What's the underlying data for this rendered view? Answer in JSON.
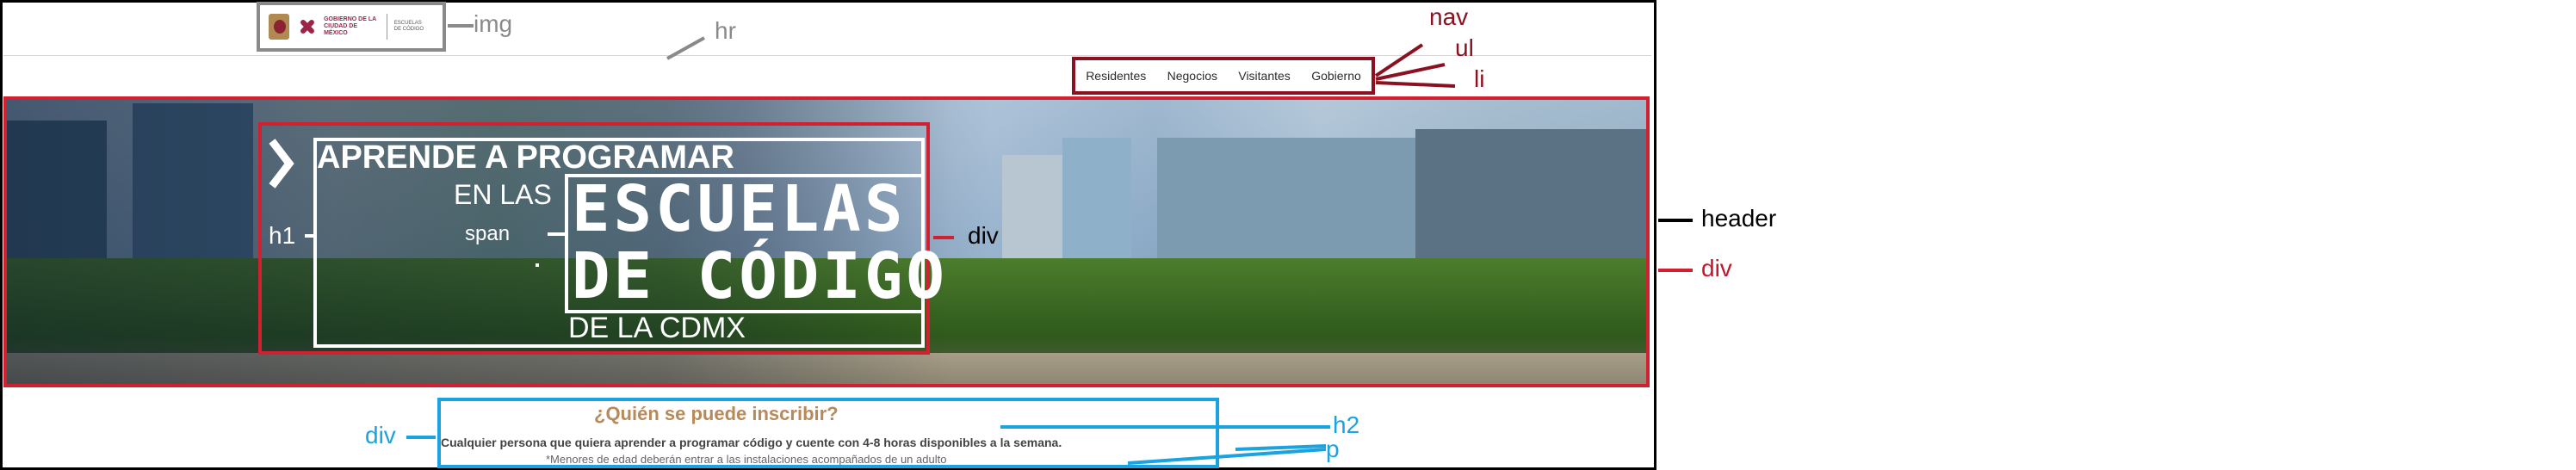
{
  "logo": {
    "line1": "GOBIERNO DE LA",
    "line2": "CIUDAD DE MÉXICO",
    "sub1": "ESCUELAS",
    "sub2": "DE CÓDIGO"
  },
  "nav": {
    "items": [
      "Residentes",
      "Negocios",
      "Visitantes",
      "Gobierno"
    ]
  },
  "hero": {
    "line1": "APRENDE A PROGRAMAR",
    "line2": "EN LAS",
    "big1": "ESCUELAS",
    "big2": "DE CÓDIGO",
    "line3": "DE LA CDMX"
  },
  "info": {
    "heading": "¿Quién se puede inscribir?",
    "p1": "Cualquier persona que quiera aprender a programar código y cuente con 4-8 horas disponibles a la semana.",
    "p2": "*Menores de edad deberán entrar a las instalaciones acompañados de un adulto"
  },
  "annotations": {
    "img": "img",
    "hr": "hr",
    "nav": "nav",
    "ul": "ul",
    "li": "li",
    "header": "header",
    "div_outer": "div",
    "div_inner": "div",
    "h1": "h1",
    "span": "span",
    "div_bottom": "div",
    "h2": "h2",
    "p": "p"
  },
  "colors": {
    "img_tag": "#8a8a8a",
    "nav_tag": "#8b1120",
    "div_tag": "#d1202f",
    "bottom_tag": "#1aa3e0",
    "heading": "#b88a5a"
  }
}
